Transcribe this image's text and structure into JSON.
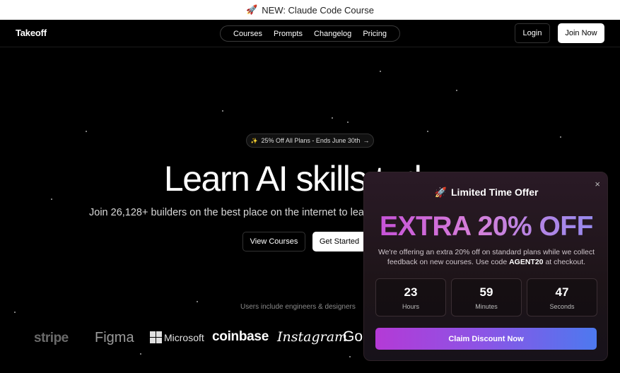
{
  "announcement": {
    "icon": "rocket-icon",
    "text": "NEW: Claude Code Course"
  },
  "nav": {
    "logo": "Takeoff",
    "links": [
      "Courses",
      "Prompts",
      "Changelog",
      "Pricing"
    ],
    "login": "Login",
    "join": "Join Now"
  },
  "hero": {
    "promo": "25% Off All Plans - Ends June 30th",
    "title": "Learn AI skills today",
    "subtitle": "Join 26,128+ builders on the best place on the internet to learn",
    "btn_view": "View Courses",
    "btn_start": "Get Started",
    "users": "Users include engineers & designers",
    "logos": [
      "stripe",
      "Figma",
      "Microsoft",
      "coinbase",
      "Instagram",
      "Go"
    ]
  },
  "popup": {
    "title": "Limited Time Offer",
    "headline": "EXTRA 20% OFF",
    "desc_before": "We're offering an extra 20% off on standard plans while we collect feedback on new courses. Use code ",
    "code": "AGENT20",
    "desc_after": " at checkout.",
    "timer": [
      {
        "value": "23",
        "label": "Hours"
      },
      {
        "value": "59",
        "label": "Minutes"
      },
      {
        "value": "47",
        "label": "Seconds"
      }
    ],
    "cta": "Claim Discount Now",
    "close": "×"
  }
}
